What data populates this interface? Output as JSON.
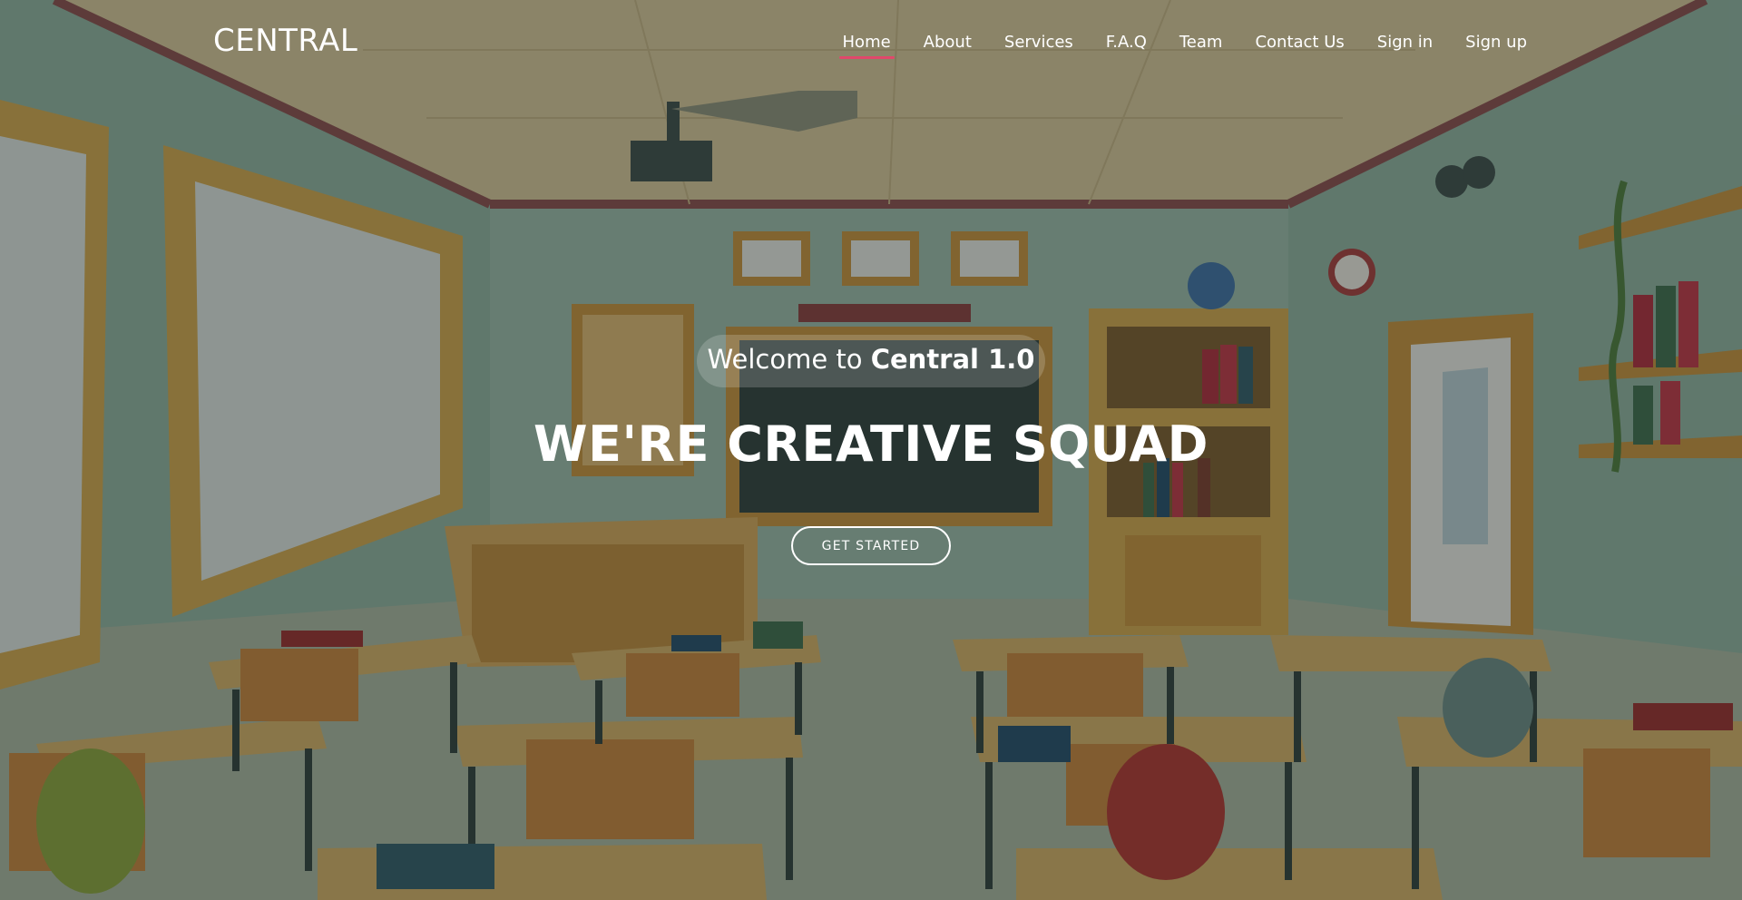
{
  "brand": {
    "name": "CENTRAL"
  },
  "nav": {
    "items": [
      {
        "label": "Home",
        "active": true
      },
      {
        "label": "About"
      },
      {
        "label": "Services"
      },
      {
        "label": "F.A.Q"
      },
      {
        "label": "Team"
      },
      {
        "label": "Contact Us"
      },
      {
        "label": "Sign in"
      },
      {
        "label": "Sign up"
      }
    ]
  },
  "hero": {
    "welcome_prefix": "Welcome to",
    "welcome_strong": "Central 1.0",
    "headline": "WE'RE CREATIVE SQUAD",
    "cta_label": "GET STARTED"
  },
  "colors": {
    "accent": "#e0486b",
    "text": "#ffffff",
    "overlay": "#1e2624"
  }
}
